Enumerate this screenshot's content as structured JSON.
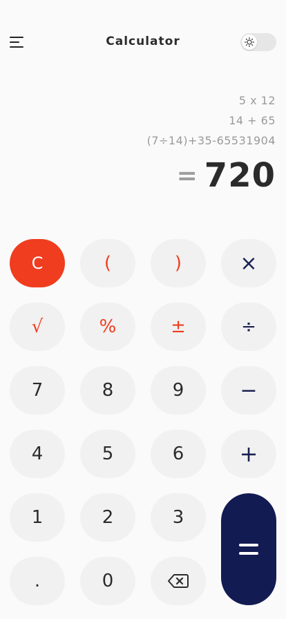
{
  "header": {
    "title": "Calculator",
    "menu_icon": "menu-icon",
    "theme_toggle_icon": "sun-icon"
  },
  "display": {
    "history": [
      "5 x 12",
      "14 + 65",
      "(7÷14)+35-65531904"
    ],
    "equals_sign": "=",
    "result": "720"
  },
  "keys": {
    "clear": "C",
    "open_paren": "(",
    "close_paren": ")",
    "multiply": "×",
    "sqrt": "√",
    "percent": "%",
    "plus_minus": "±",
    "divide": "÷",
    "seven": "7",
    "eight": "8",
    "nine": "9",
    "minus": "−",
    "four": "4",
    "five": "5",
    "six": "6",
    "plus": "+",
    "one": "1",
    "two": "2",
    "three": "3",
    "dot": ".",
    "zero": "0",
    "backspace_icon": "backspace-icon",
    "equals_icon": "equals-icon"
  },
  "colors": {
    "accent_red": "#f03c1f",
    "navy": "#131b53",
    "key_bg": "#f1f1f1",
    "background": "#fafafa"
  }
}
